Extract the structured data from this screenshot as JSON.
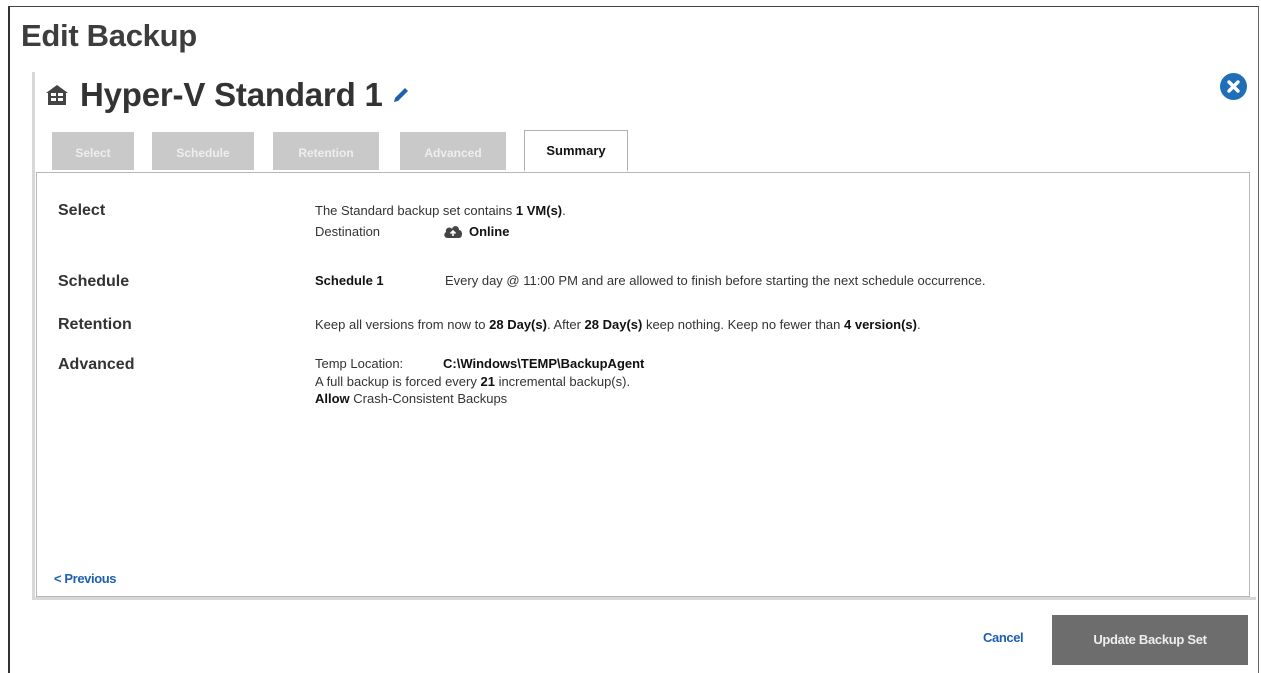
{
  "page": {
    "title": "Edit Backup"
  },
  "backup_set": {
    "name": "Hyper-V Standard 1"
  },
  "tabs": [
    {
      "label": "Select"
    },
    {
      "label": "Schedule"
    },
    {
      "label": "Retention"
    },
    {
      "label": "Advanced"
    },
    {
      "label": "Summary"
    }
  ],
  "summary": {
    "select": {
      "label": "Select",
      "line1_prefix": "The Standard backup set contains ",
      "vm_count": "1 VM(s)",
      "line1_suffix": ".",
      "destination_label": "Destination",
      "destination_value": "Online"
    },
    "schedule": {
      "label": "Schedule",
      "name": "Schedule 1",
      "description": "Every day @ 11:00 PM and are allowed to finish before starting the next schedule occurrence."
    },
    "retention": {
      "label": "Retention",
      "part1": "Keep all versions from now to ",
      "days1": "28 Day(s)",
      "part2": ". After ",
      "days2": "28 Day(s)",
      "part3": " keep nothing. Keep no fewer than ",
      "versions": "4 version(s)",
      "part4": "."
    },
    "advanced": {
      "label": "Advanced",
      "temp_label": "Temp Location:",
      "temp_value": "C:\\Windows\\TEMP\\BackupAgent",
      "full_prefix": "A full backup is forced every ",
      "full_count": "21",
      "full_suffix": " incremental backup(s).",
      "allow_word": "Allow",
      "allow_text": " Crash-Consistent Backups"
    }
  },
  "nav": {
    "previous_label": "< Previous"
  },
  "footer": {
    "cancel_label": "Cancel",
    "update_label": "Update Backup Set"
  },
  "colors": {
    "accent": "#1f5fb0",
    "close_button": "#1f6fb8",
    "tab_inactive": "#c9c9c9",
    "update_button": "#6d6d6d"
  },
  "icons": {
    "vm": "virtual-machine-icon",
    "edit": "pencil-icon",
    "close": "close-icon",
    "destination": "cloud-icon"
  }
}
